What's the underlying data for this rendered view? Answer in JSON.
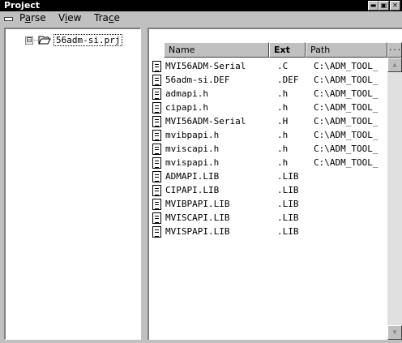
{
  "window": {
    "title": "Project",
    "buttons": [
      "▬",
      "▣",
      "✕"
    ]
  },
  "menu": {
    "items": [
      {
        "label": "Parse",
        "key": "a"
      },
      {
        "label": "View",
        "key": "i"
      },
      {
        "label": "Trace",
        "key": "c"
      }
    ]
  },
  "tree": {
    "expander": "⊟",
    "root_label": "56adm-si.prj"
  },
  "list": {
    "columns": [
      "Name",
      "Ext",
      "Path"
    ],
    "overflow_label": "...",
    "scroll_up": "▲",
    "scroll_down": "▼",
    "rows": [
      {
        "name": "MVI56ADM-Serial",
        "ext": ".C",
        "path": "C:\\ADM_TOOL_"
      },
      {
        "name": "56adm-si.DEF",
        "ext": ".DEF",
        "path": "C:\\ADM_TOOL_"
      },
      {
        "name": "admapi.h",
        "ext": ".h",
        "path": "C:\\ADM_TOOL_"
      },
      {
        "name": "cipapi.h",
        "ext": ".h",
        "path": "C:\\ADM_TOOL_"
      },
      {
        "name": "MVI56ADM-Serial",
        "ext": ".H",
        "path": "C:\\ADM_TOOL_"
      },
      {
        "name": "mvibpapi.h",
        "ext": ".h",
        "path": "C:\\ADM_TOOL_"
      },
      {
        "name": "mviscapi.h",
        "ext": ".h",
        "path": "C:\\ADM_TOOL_"
      },
      {
        "name": "mvispapi.h",
        "ext": ".h",
        "path": "C:\\ADM_TOOL_"
      },
      {
        "name": "ADMAPI.LIB",
        "ext": ".LIB",
        "path": ""
      },
      {
        "name": "CIPAPI.LIB",
        "ext": ".LIB",
        "path": ""
      },
      {
        "name": "MVIBPAPI.LIB",
        "ext": ".LIB",
        "path": ""
      },
      {
        "name": "MVISCAPI.LIB",
        "ext": ".LIB",
        "path": ""
      },
      {
        "name": "MVISPAPI.LIB",
        "ext": ".LIB",
        "path": ""
      }
    ]
  }
}
